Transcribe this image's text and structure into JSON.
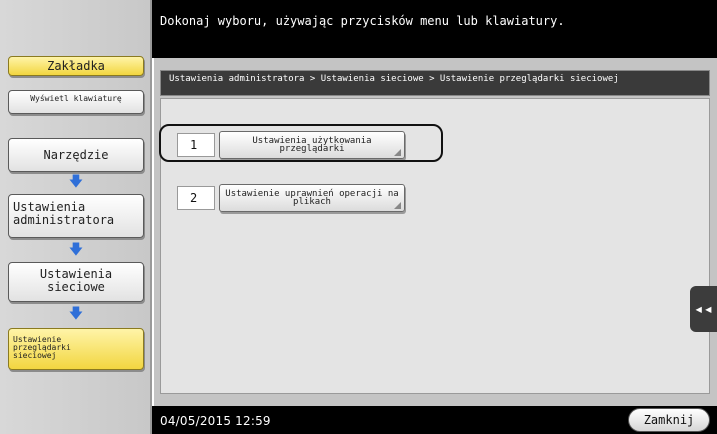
{
  "sidebar": {
    "tab_label": "Zakładka",
    "keyboard_label": "Wyświetl klawiaturę",
    "steps": [
      {
        "label": "Narzędzie"
      },
      {
        "label": "Ustawienia administratora"
      },
      {
        "label": "Ustawienia sieciowe"
      },
      {
        "label": "Ustawienie przeglądarki sieciowej"
      }
    ],
    "arrow_icon": "down-arrow-icon"
  },
  "header": {
    "message": "Dokonaj wyboru, używając przycisków menu lub klawiatury."
  },
  "breadcrumb": {
    "text": "Ustawienia administratora > Ustawienia sieciowe > Ustawienie przeglądarki sieciowej"
  },
  "options": [
    {
      "number": "1",
      "label": "Ustawienia użytkowania przeglądarki"
    },
    {
      "number": "2",
      "label": "Ustawienie uprawnień operacji na plikach"
    }
  ],
  "footer": {
    "datetime": "04/05/2015   12:59",
    "close_label": "Zamknij"
  },
  "side_tab": {
    "icon": "double-chevron-left-icon",
    "glyph": "◂◂"
  },
  "colors": {
    "accent_yellow": "#f2d640",
    "arrow_blue": "#2f6fd8",
    "bar_black": "#000000",
    "panel_grey": "#c4c4c4"
  }
}
